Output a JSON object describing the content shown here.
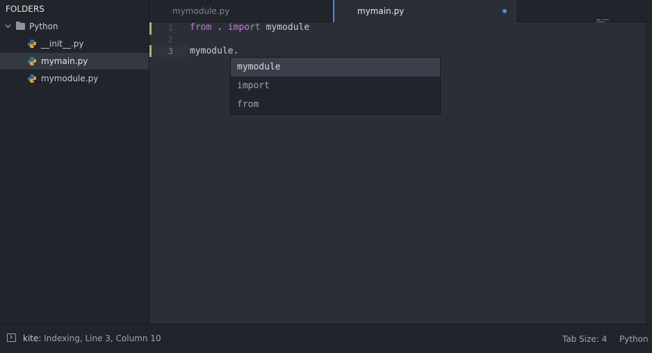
{
  "sidebar": {
    "title": "FOLDERS",
    "folder": {
      "label": "Python",
      "expanded": true
    },
    "files": [
      {
        "label": "__init__.py",
        "selected": false
      },
      {
        "label": "mymain.py",
        "selected": true
      },
      {
        "label": "mymodule.py",
        "selected": false
      }
    ]
  },
  "tabs": [
    {
      "label": "mymodule.py",
      "active": false
    },
    {
      "label": "mymain.py",
      "active": true,
      "modified": true
    }
  ],
  "editor": {
    "current_line": 3,
    "lines": [
      {
        "num": "1",
        "tokens": [
          {
            "text": "from",
            "type": "keyword"
          },
          {
            "text": " . ",
            "type": "plain"
          },
          {
            "text": "import",
            "type": "keyword"
          },
          {
            "text": " mymodule",
            "type": "plain"
          }
        ]
      },
      {
        "num": "2",
        "tokens": []
      },
      {
        "num": "3",
        "tokens": [
          {
            "text": "mymodule.",
            "type": "plain"
          }
        ]
      }
    ]
  },
  "autocomplete": {
    "items": [
      "mymodule",
      "import",
      "from"
    ],
    "selected_index": 0
  },
  "statusbar": {
    "kite_label": "kite:",
    "message": "Indexing, Line 3, Column 10",
    "tab_size": "Tab Size: 4",
    "language": "Python"
  },
  "colors": {
    "accent": "#568af2",
    "keyword": "#c678dd",
    "git_added": "#98c379",
    "python_blue": "#3572A5",
    "python_yellow": "#e8a73a"
  },
  "icons": [
    "chevron-down-icon",
    "folder-icon",
    "python-file-icon",
    "modified-dot-icon",
    "terminal-icon"
  ]
}
